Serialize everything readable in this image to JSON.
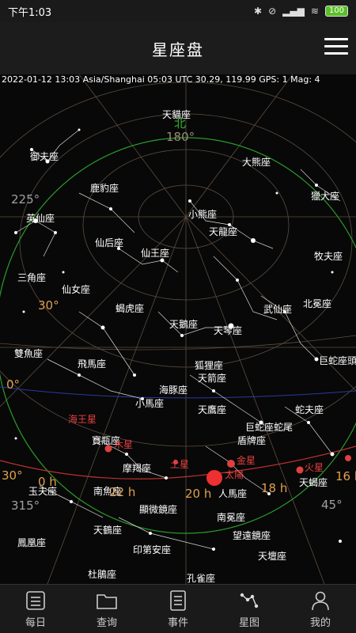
{
  "status": {
    "time": "下午1:03",
    "battery": "100"
  },
  "header": {
    "title": "星座盘"
  },
  "info": {
    "line": "2022-01-12 13:03 Asia/Shanghai 05:03 UTC 30.29, 119.99 GPS: 1 Mag: 4"
  },
  "constellations": [
    "天貓座",
    "大熊座",
    "御夫座",
    "鹿豹座",
    "獵犬座",
    "英仙座",
    "小熊座",
    "天龍座",
    "仙后座",
    "仙王座",
    "牧夫座",
    "三角座",
    "仙女座",
    "蝎虎座",
    "武仙座",
    "北冕座",
    "天鵝座",
    "天琴座",
    "雙魚座",
    "飛馬座",
    "狐狸座",
    "巨蛇座頭",
    "天箭座",
    "海豚座",
    "小馬座",
    "天鷹座",
    "蛇夫座",
    "巨蛇座蛇尾",
    "盾牌座",
    "寶瓶座",
    "摩羯座",
    "天蝎座",
    "玉夫座",
    "南魚座",
    "人馬座",
    "顯微鏡座",
    "天鶴座",
    "南冕座",
    "望遠鏡座",
    "鳳凰座",
    "印第安座",
    "天壇座",
    "杜鵑座",
    "孔雀座"
  ],
  "planets": [
    "海王星",
    "木星",
    "土星",
    "金星",
    "太陽",
    "火星"
  ],
  "degree_labels": [
    "180°",
    "225°",
    "30°",
    "0°",
    "30°",
    "315°",
    "45°"
  ],
  "hour_labels": [
    "0 h",
    "22 h",
    "20 h",
    "18 h",
    "16 h"
  ],
  "compass": {
    "north": "北"
  },
  "nav": [
    {
      "label": "每日",
      "icon": "calendar-list-icon"
    },
    {
      "label": "查询",
      "icon": "folder-icon"
    },
    {
      "label": "事件",
      "icon": "document-icon"
    },
    {
      "label": "星图",
      "icon": "constellation-icon"
    },
    {
      "label": "我的",
      "icon": "user-icon"
    }
  ]
}
